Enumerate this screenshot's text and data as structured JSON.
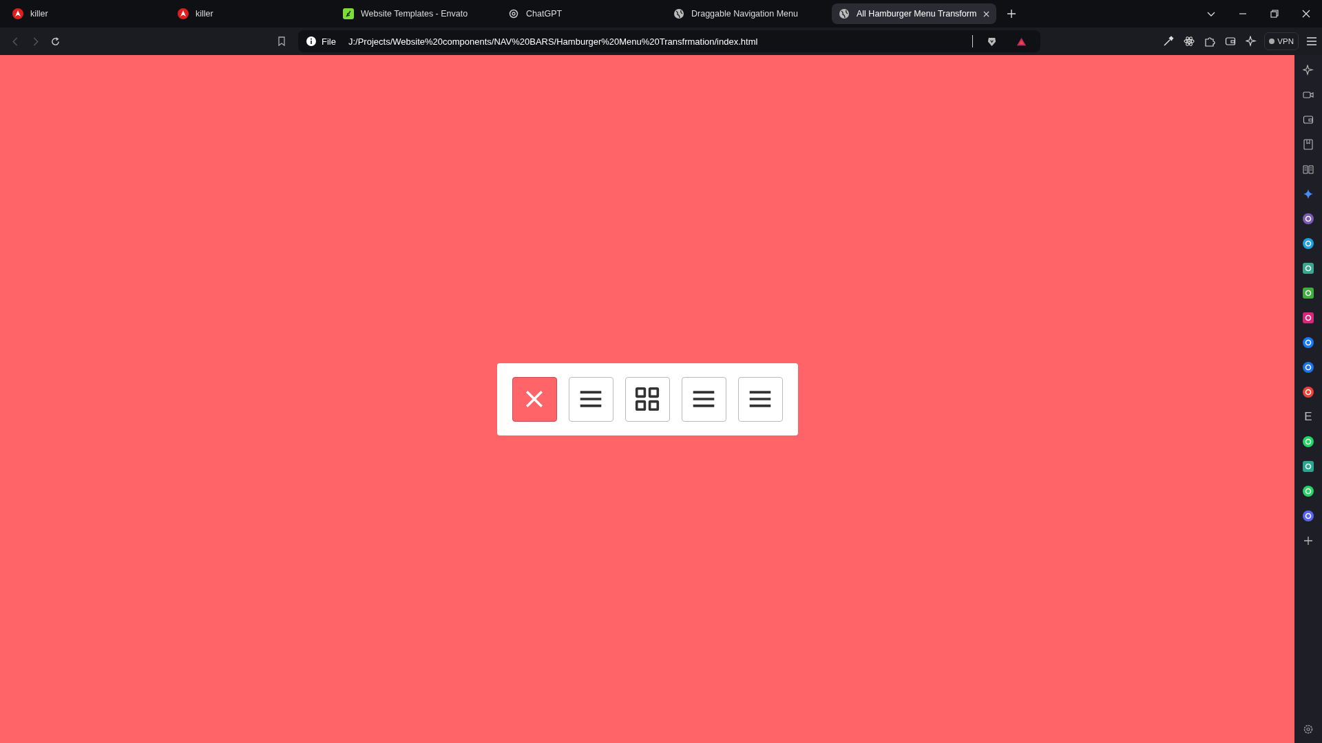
{
  "tabs": [
    {
      "title": "killer",
      "kind": "lion",
      "selected": false
    },
    {
      "title": "killer",
      "kind": "lion",
      "selected": false
    },
    {
      "title": "Website Templates - Envato",
      "kind": "leaf",
      "selected": false
    },
    {
      "title": "ChatGPT",
      "kind": "knot",
      "selected": false
    },
    {
      "title": "Draggable Navigation Menu",
      "kind": "globe",
      "selected": false
    },
    {
      "title": "All Hamburger Menu Transform",
      "kind": "globe",
      "selected": true
    }
  ],
  "address_bar": {
    "scheme": "File",
    "url": "J:/Projects/Website%20components/NAV%20BARS/Hamburger%20Menu%20Transfrmation/index.html"
  },
  "vpn_button": "VPN",
  "sidebar": {
    "letter_icon": "E"
  },
  "menu_buttons": [
    {
      "kind": "close",
      "active": true
    },
    {
      "kind": "bars",
      "active": false
    },
    {
      "kind": "grid",
      "active": false
    },
    {
      "kind": "bars",
      "active": false
    },
    {
      "kind": "bars",
      "active": false
    }
  ]
}
